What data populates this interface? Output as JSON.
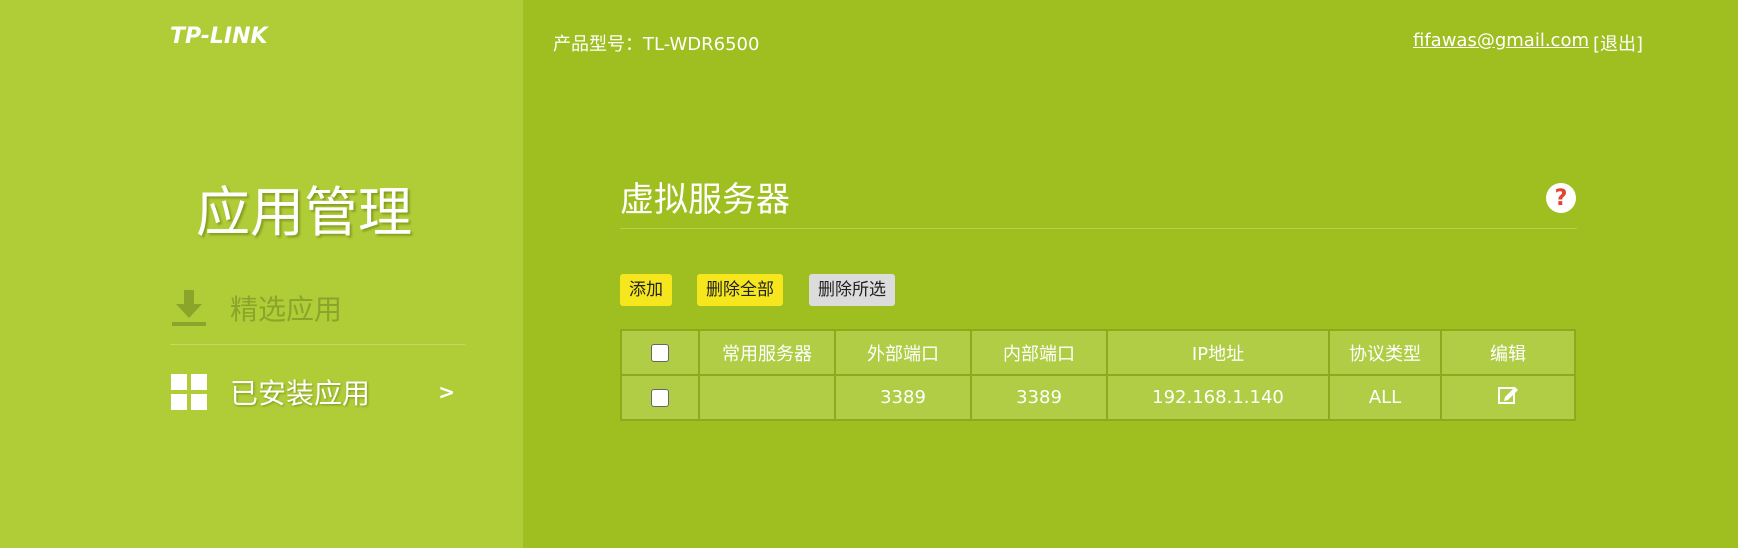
{
  "brand": {
    "logo_text": "TP-LINK"
  },
  "header": {
    "model": "产品型号：TL-WDR6500",
    "email": "fifawas@gmail.com",
    "logout": "[退出]"
  },
  "sidebar": {
    "title": "应用管理",
    "items": [
      {
        "label": "精选应用",
        "icon": "download-icon"
      },
      {
        "label": "已安装应用",
        "icon": "grid-icon",
        "arrow": ">"
      }
    ]
  },
  "section": {
    "title": "虚拟服务器",
    "help": "?"
  },
  "toolbar": {
    "add_label": "添加",
    "delete_all_label": "删除全部",
    "delete_selected_label": "删除所选"
  },
  "table": {
    "headers": [
      "",
      "常用服务器",
      "外部端口",
      "内部端口",
      "IP地址",
      "协议类型",
      "编辑"
    ],
    "rows": [
      {
        "server": "",
        "external_port": "3389",
        "internal_port": "3389",
        "ip": "192.168.1.140",
        "protocol": "ALL"
      }
    ]
  },
  "colors": {
    "sidebar_bg": "#b0cc37",
    "main_bg": "#9fbe1f",
    "button_yellow": "#f5e61d",
    "button_gray": "#dcdcdc",
    "help_red": "#e8402a"
  }
}
